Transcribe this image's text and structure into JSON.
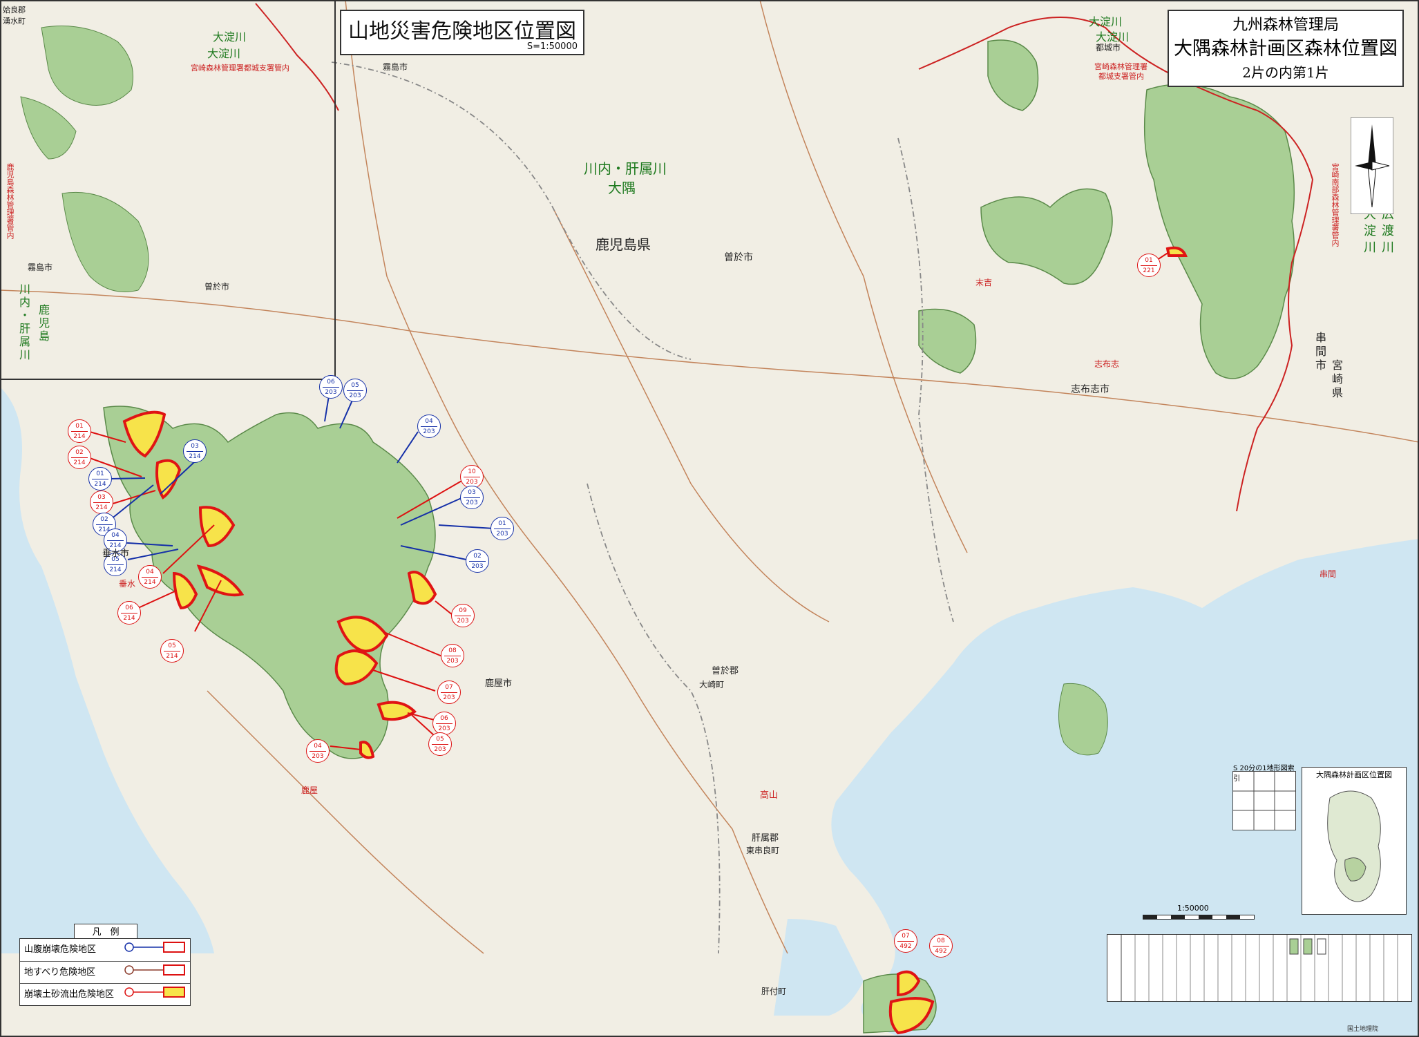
{
  "title": "山地災害危険地区位置図",
  "scale": "S=1:50000",
  "header": {
    "line1": "九州森林管理局",
    "line2": "大隅森林計画区森林位置図",
    "line3": "2片の内第1片"
  },
  "labels": {
    "river_main_1": "川内・肝属川",
    "river_main_2": "大隅",
    "pref_kagoshima": "鹿児島県",
    "city_soo": "曽於市",
    "city_shibushi": "志布志市",
    "city_kanoya": "鹿屋市",
    "city_kirishima": "霧島市",
    "city_miyakonojo": "都城市",
    "town_osaki_1": "曽於郡",
    "town_osaki_2": "大崎町",
    "town_higashikushira_1": "肝属郡",
    "town_higashikushira_2": "東串良町",
    "town_kimotsuki": "肝付町",
    "city_tarumizu": "垂水市",
    "inset_river_1": "大淀川",
    "inset_river_2": "大淀川",
    "inset_office": "宮崎森林管理署都城支署管内",
    "tr_river_1": "大淀川",
    "tr_river_2": "大淀川",
    "tr_office_1": "宮崎森林管理署",
    "tr_office_2": "都城支署管内",
    "right_pref": "宮崎県",
    "right_city": "串間市",
    "right_river_1": "大淀川",
    "right_river_2": "広渡川",
    "right_office": "宮崎南部森林管理署管内",
    "inset_left_office": "鹿児島森林管理署管内",
    "inset_left_river_1": "川内・肝属川",
    "inset_left_river_2": "鹿児島",
    "inset_corner": "姶良郡湧水町",
    "inset_city_kirishima": "霧島市",
    "inset_city_soo": "曽於市",
    "red_takayama": "高山",
    "red_kanoya": "鹿屋",
    "red_sueyoshi": "末吉",
    "red_shibushi": "志布志",
    "red_kushima": "串間",
    "red_tarumizu": "垂水"
  },
  "legend": {
    "heading": "凡　例",
    "items": [
      {
        "label": "山腹崩壊危険地区",
        "color": "#1530a8"
      },
      {
        "label": "地すべり危険地区",
        "color": "#8a3a2a"
      },
      {
        "label": "崩壊土砂流出危険地区",
        "color": "#d11"
      }
    ]
  },
  "inset_map_title": "大隅森林計画区位置図",
  "scale_bar": "1:50000",
  "index_title": "S 20分の1地形図索引",
  "credit": "国土地理院",
  "markers": [
    {
      "top": "01",
      "bottom": "214",
      "color": "red"
    },
    {
      "top": "02",
      "bottom": "214",
      "color": "red"
    },
    {
      "top": "01",
      "bottom": "214",
      "color": "blue"
    },
    {
      "top": "03",
      "bottom": "214",
      "color": "red"
    },
    {
      "top": "02",
      "bottom": "214",
      "color": "blue"
    },
    {
      "top": "03",
      "bottom": "214",
      "color": "blue"
    },
    {
      "top": "04",
      "bottom": "214",
      "color": "blue"
    },
    {
      "top": "05",
      "bottom": "214",
      "color": "blue"
    },
    {
      "top": "04",
      "bottom": "214",
      "color": "red"
    },
    {
      "top": "06",
      "bottom": "214",
      "color": "red"
    },
    {
      "top": "05",
      "bottom": "214",
      "color": "red"
    },
    {
      "top": "06",
      "bottom": "203",
      "color": "blue"
    },
    {
      "top": "05",
      "bottom": "203",
      "color": "blue"
    },
    {
      "top": "04",
      "bottom": "203",
      "color": "blue"
    },
    {
      "top": "10",
      "bottom": "203",
      "color": "red"
    },
    {
      "top": "03",
      "bottom": "203",
      "color": "blue"
    },
    {
      "top": "01",
      "bottom": "203",
      "color": "blue"
    },
    {
      "top": "02",
      "bottom": "203",
      "color": "blue"
    },
    {
      "top": "09",
      "bottom": "203",
      "color": "red"
    },
    {
      "top": "08",
      "bottom": "203",
      "color": "red"
    },
    {
      "top": "07",
      "bottom": "203",
      "color": "red"
    },
    {
      "top": "06",
      "bottom": "203",
      "color": "red"
    },
    {
      "top": "05",
      "bottom": "203",
      "color": "red"
    },
    {
      "top": "04",
      "bottom": "203",
      "color": "red"
    },
    {
      "top": "01",
      "bottom": "221",
      "color": "red"
    },
    {
      "top": "07",
      "bottom": "492",
      "color": "red"
    },
    {
      "top": "08",
      "bottom": "492",
      "color": "red"
    }
  ]
}
